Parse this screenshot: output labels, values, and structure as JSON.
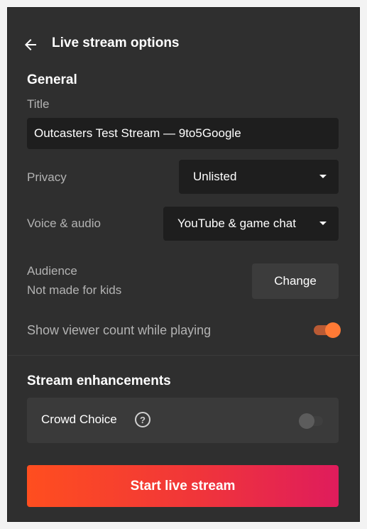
{
  "header": {
    "back_icon": "arrow-left-icon",
    "title": "Live stream options"
  },
  "general": {
    "section_title": "General",
    "title_label": "Title",
    "title_value": "Outcasters Test Stream — 9to5Google",
    "privacy_label": "Privacy",
    "privacy_value": "Unlisted",
    "voice_label": "Voice & audio",
    "voice_value": "YouTube & game chat",
    "audience_label": "Audience",
    "audience_value": "Not made for kids",
    "change_label": "Change",
    "viewer_count_label": "Show viewer count while playing",
    "viewer_count_enabled": true
  },
  "enhancements": {
    "section_title": "Stream enhancements",
    "crowd_choice_label": "Crowd Choice",
    "help_icon": "question-circle-icon",
    "crowd_choice_enabled": false
  },
  "start_button_label": "Start live stream",
  "colors": {
    "panel_bg": "#2f2f2f",
    "field_bg": "#1e1e1e",
    "accent_orange": "#ff7a35",
    "gradient_start": "#ff4e1f",
    "gradient_end": "#df1c5c"
  }
}
